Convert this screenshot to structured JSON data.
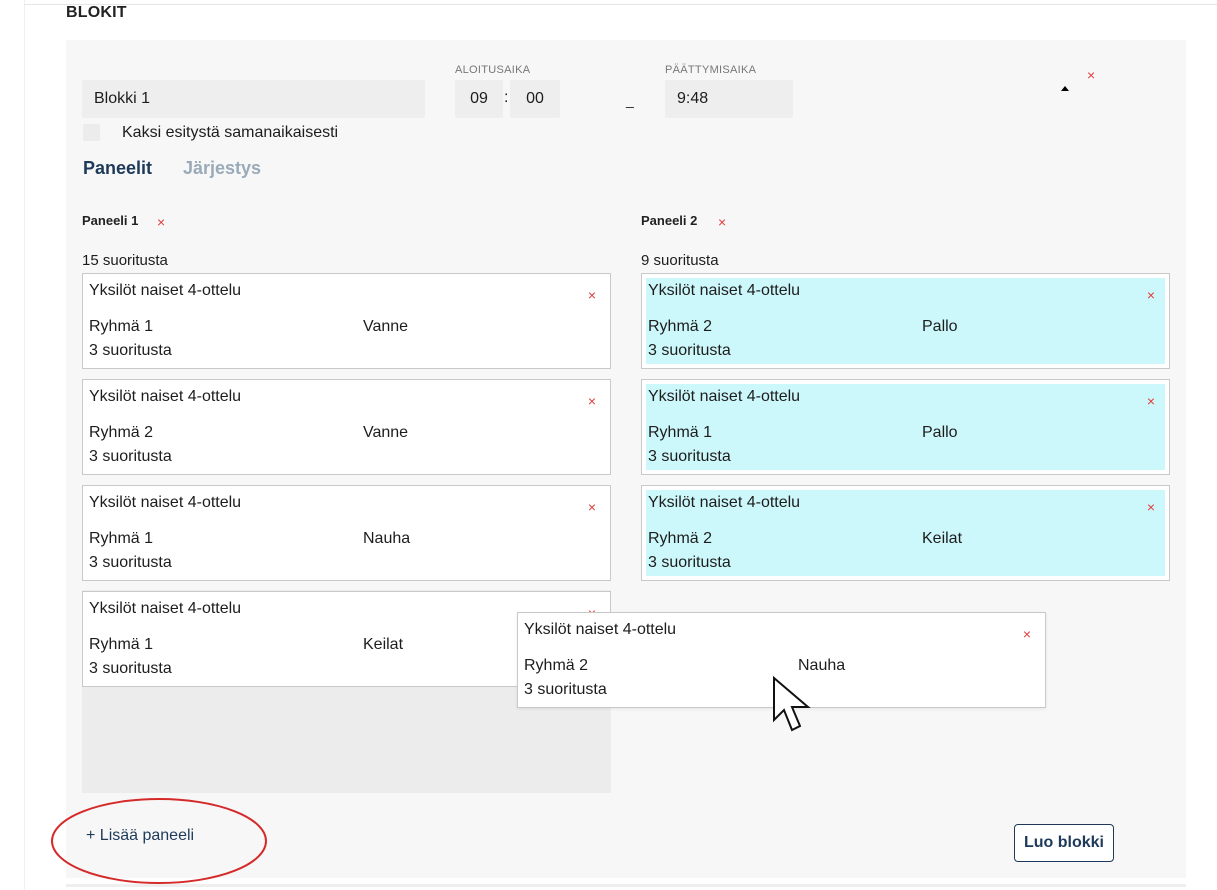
{
  "section_title": "BLOKIT",
  "block": {
    "name": "Blokki 1",
    "start_label": "ALOITUSAIKA",
    "end_label": "PÄÄTTYMISAIKA",
    "start_hour": "09",
    "start_minute": "00",
    "time_separator": ":",
    "range_dash": "_",
    "end_time": "9:48",
    "simultaneous_label": "Kaksi esitystä samanaikaisesti",
    "close_glyph": "×"
  },
  "tabs": [
    "Paneelit",
    "Järjestys"
  ],
  "panels": [
    {
      "title": "Paneeli 1",
      "count": "15 suoritusta",
      "cards": [
        {
          "title": "Yksilöt naiset 4-ottelu",
          "group": "Ryhmä 1",
          "apparatus": "Vanne",
          "count": "3 suoritusta"
        },
        {
          "title": "Yksilöt naiset 4-ottelu",
          "group": "Ryhmä 2",
          "apparatus": "Vanne",
          "count": "3 suoritusta"
        },
        {
          "title": "Yksilöt naiset 4-ottelu",
          "group": "Ryhmä 1",
          "apparatus": "Nauha",
          "count": "3 suoritusta"
        },
        {
          "title": "Yksilöt naiset 4-ottelu",
          "group": "Ryhmä 1",
          "apparatus": "Keilat",
          "count": "3 suoritusta"
        }
      ]
    },
    {
      "title": "Paneeli 2",
      "count": "9 suoritusta",
      "highlight_color": "#cdf8fb",
      "cards": [
        {
          "title": "Yksilöt naiset 4-ottelu",
          "group": "Ryhmä 2",
          "apparatus": "Pallo",
          "count": "3 suoritusta"
        },
        {
          "title": "Yksilöt naiset 4-ottelu",
          "group": "Ryhmä 1",
          "apparatus": "Pallo",
          "count": "3 suoritusta"
        },
        {
          "title": "Yksilöt naiset 4-ottelu",
          "group": "Ryhmä 2",
          "apparatus": "Keilat",
          "count": "3 suoritusta"
        }
      ]
    }
  ],
  "dragged_card": {
    "title": "Yksilöt naiset 4-ottelu",
    "group": "Ryhmä 2",
    "apparatus": "Nauha",
    "count": "3 suoritusta"
  },
  "add_panel_label": "+ Lisää paneeli",
  "create_block_label": "Luo blokki",
  "colors": {
    "accent": "#1e3a5a",
    "delete": "#e23b3b",
    "highlight": "#cdf8fb",
    "annotation": "#d42a2a"
  }
}
